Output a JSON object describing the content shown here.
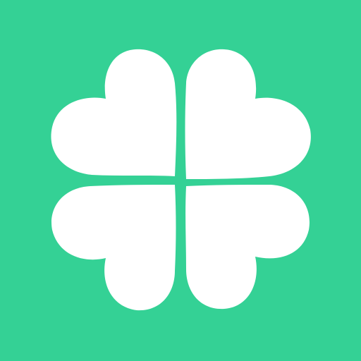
{
  "icon": {
    "name": "four-leaf-clover-icon",
    "background_color": "#34D195",
    "leaf_color": "#FFFFFF"
  }
}
